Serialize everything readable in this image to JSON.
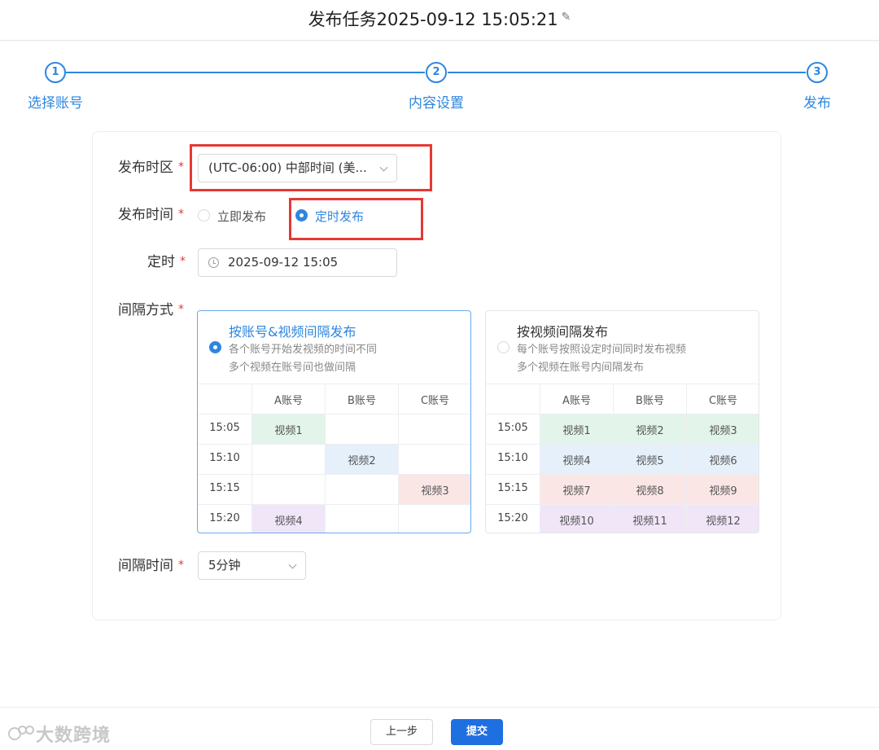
{
  "header": {
    "title": "发布任务2025-09-12 15:05:21",
    "edit_icon": "pencil-icon"
  },
  "steps": [
    {
      "num": "1",
      "label": "选择账号"
    },
    {
      "num": "2",
      "label": "内容设置"
    },
    {
      "num": "3",
      "label": "发布"
    }
  ],
  "form": {
    "timezone": {
      "label": "发布时区",
      "required": "*",
      "value": "(UTC-06:00) 中部时间 (美..."
    },
    "publish_time": {
      "label": "发布时间",
      "required": "*",
      "options": [
        "立即发布",
        "定时发布"
      ],
      "selected": "定时发布"
    },
    "schedule": {
      "label": "定时",
      "required": "*",
      "value": "2025-09-12 15:05"
    },
    "interval_mode": {
      "label": "间隔方式",
      "required": "*",
      "options": [
        {
          "title": "按账号&视频间隔发布",
          "desc1": "各个账号开始发视频的时间不同",
          "desc2": "多个视频在账号间也做间隔",
          "selected": true,
          "headers": [
            "",
            "A账号",
            "B账号",
            "C账号"
          ],
          "rows": [
            [
              "15:05",
              "视频1",
              "",
              ""
            ],
            [
              "15:10",
              "",
              "视频2",
              ""
            ],
            [
              "15:15",
              "",
              "",
              "视频3"
            ],
            [
              "15:20",
              "视频4",
              "",
              ""
            ]
          ]
        },
        {
          "title": "按视频间隔发布",
          "desc1": "每个账号按照设定时间同时发布视频",
          "desc2": "多个视频在账号内间隔发布",
          "selected": false,
          "headers": [
            "",
            "A账号",
            "B账号",
            "C账号"
          ],
          "rows": [
            [
              "15:05",
              "视频1",
              "视频2",
              "视频3"
            ],
            [
              "15:10",
              "视频4",
              "视频5",
              "视频6"
            ],
            [
              "15:15",
              "视频7",
              "视频8",
              "视频9"
            ],
            [
              "15:20",
              "视频10",
              "视频11",
              "视频12"
            ]
          ]
        }
      ]
    },
    "interval_time": {
      "label": "间隔时间",
      "required": "*",
      "value": "5分钟"
    }
  },
  "footer": {
    "prev_label": "上一步",
    "submit_label": "提交"
  },
  "watermark": "大数跨境",
  "colors": {
    "accent": "#2e86de",
    "highlight": "#e53935",
    "submit": "#1e6fe0"
  }
}
